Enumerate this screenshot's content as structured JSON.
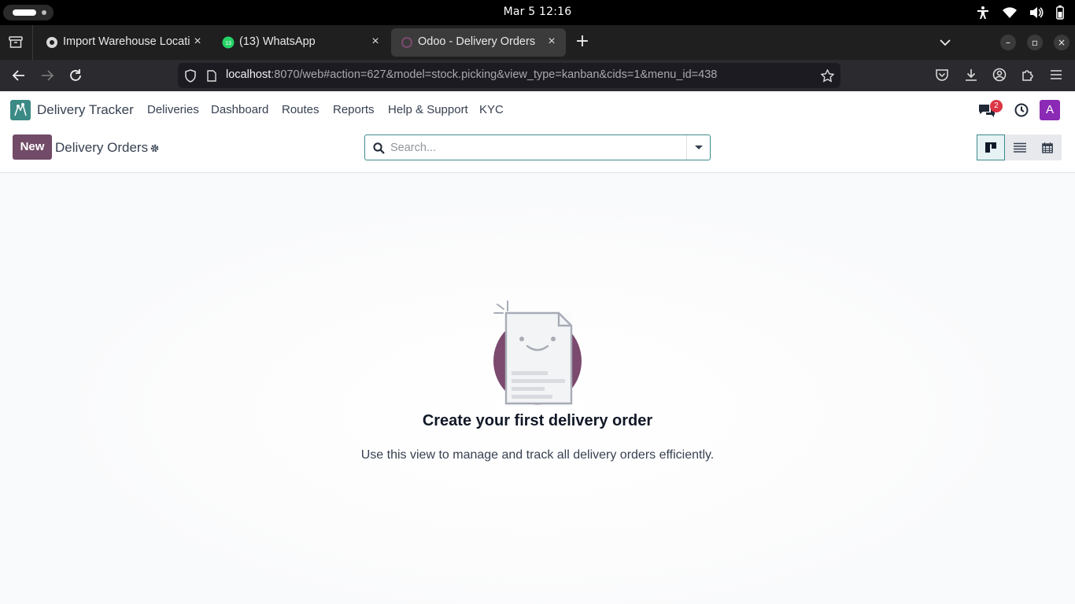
{
  "system": {
    "clock": "Mar 5  12:16",
    "tray_icons": [
      "accessibility-icon",
      "wifi-icon",
      "volume-icon",
      "battery-icon"
    ]
  },
  "browser": {
    "tabs": [
      {
        "title": "Import Warehouse Locati",
        "favicon": "odoo-grey-icon",
        "active": false
      },
      {
        "title": "(13) WhatsApp",
        "favicon": "whatsapp-icon",
        "badge": "13",
        "active": false
      },
      {
        "title": "Odoo - Delivery Orders",
        "favicon": "odoo-loading-icon",
        "active": true
      }
    ],
    "new_tab": "+",
    "url_host": "localhost",
    "url_rest": ":8070/web#action=627&model=stock.picking&view_type=kanban&cids=1&menu_id=438"
  },
  "odoo": {
    "app_name": "Delivery Tracker",
    "menus": [
      "Deliveries",
      "Dashboard",
      "Routes",
      "Reports",
      "Help & Support",
      "KYC"
    ],
    "messaging_badge": "2",
    "avatar_letter": "A",
    "new_button": "New",
    "page_title": "Delivery Orders",
    "search_placeholder": "Search...",
    "views": [
      "kanban",
      "list",
      "calendar"
    ],
    "active_view": "kanban",
    "empty_title": "Create your first delivery order",
    "empty_text": "Use this view to manage and track all delivery orders efficiently.",
    "colors": {
      "brand": "#714b67",
      "accent": "#3d8b8c",
      "badge": "#dc3545",
      "avatar": "#8a2ab5"
    }
  }
}
